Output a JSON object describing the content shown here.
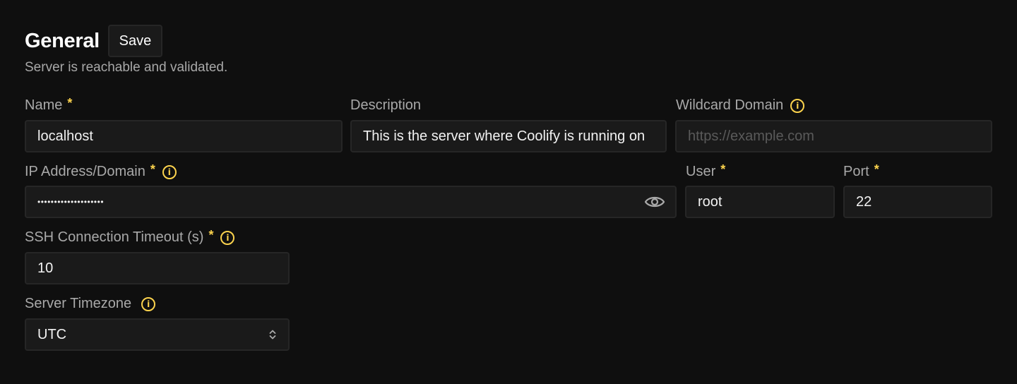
{
  "header": {
    "title": "General",
    "save_label": "Save",
    "status": "Server is reachable and validated."
  },
  "fields": {
    "name": {
      "label": "Name",
      "required": "*",
      "value": "localhost"
    },
    "description": {
      "label": "Description",
      "value": "This is the server where Coolify is running on"
    },
    "wildcard_domain": {
      "label": "Wildcard Domain",
      "placeholder": "https://example.com",
      "icon": "info-icon"
    },
    "ip_address": {
      "label": "IP Address/Domain",
      "required": "*",
      "masked_value": "••••••••••••••••••••",
      "icon": "info-icon",
      "toggle_icon": "eye-icon"
    },
    "user": {
      "label": "User",
      "required": "*",
      "value": "root"
    },
    "port": {
      "label": "Port",
      "required": "*",
      "value": "22"
    },
    "ssh_timeout": {
      "label": "SSH Connection Timeout (s)",
      "required": "*",
      "value": "10",
      "icon": "info-icon"
    },
    "timezone": {
      "label": "Server Timezone",
      "value": "UTC",
      "icon": "info-icon"
    }
  },
  "colors": {
    "background": "#0f0f0f",
    "field_bg": "#1a1a1a",
    "field_border": "#262626",
    "accent": "#fcd34d"
  }
}
